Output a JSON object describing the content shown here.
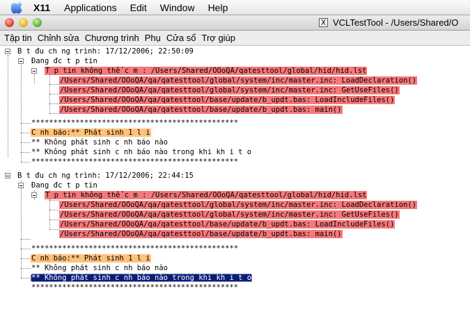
{
  "mac_menubar": {
    "app": "X11",
    "items": [
      "Applications",
      "Edit",
      "Window",
      "Help"
    ]
  },
  "window": {
    "title": "VCLTestTool - /Users/Shared/O"
  },
  "app_menu": {
    "items": [
      "Tập tin",
      "Chỉnh sửa",
      "Chương trình",
      "Phụ",
      "Cửa sổ",
      "Trợ giúp"
    ]
  },
  "tree": {
    "run1": {
      "root": "B t đu ch  ng trình: 17/12/2006; 22:50:09",
      "reading": "Đang đc t p tin",
      "error": "T p tin không thể    c m : /Users/Shared/OOoQA/qatesttool/global/hid/hid.lst",
      "stack": [
        "/Users/Shared/OOoQA/qa/qatesttool/global/system/inc/master.inc: LoadDeclaration()",
        "/Users/Shared/OOoQA/qa/qatesttool/global/system/inc/master.inc: GetUseFiles()",
        "/Users/Shared/OOoQA/qa/qatesttool/base/update/b_updt.bas: LoadIncludeFiles()",
        "/Users/Shared/OOoQA/qa/qatesttool/base/update/b_updt.bas: main()"
      ],
      "sep1": "***********************************************",
      "warning": "C nh báo:** Phát sinh 1 l i",
      "info1": "** Không phát sinh c nh báo nào",
      "info2": "** Không phát sinh c nh báo nào trong khi kh i t o",
      "sep2": "***********************************************"
    },
    "run2": {
      "root": "B t đu ch  ng trình: 17/12/2006; 22:44:15",
      "reading": "Đang đc t p tin",
      "error": "T p tin không thể    c m : /Users/Shared/OOoQA/qatesttool/global/hid/hid.lst",
      "stack": [
        "/Users/Shared/OOoQA/qa/qatesttool/global/system/inc/master.inc: LoadDeclaration()",
        "/Users/Shared/OOoQA/qa/qatesttool/global/system/inc/master.inc: GetUseFiles()",
        "/Users/Shared/OOoQA/qa/qatesttool/base/update/b_updt.bas: LoadIncludeFiles()",
        "/Users/Shared/OOoQA/qa/qatesttool/base/update/b_updt.bas: main()"
      ],
      "sep1": "***********************************************",
      "warning": "C nh báo:** Phát sinh 1 l i",
      "info1": "** Không phát sinh c nh báo nào",
      "info2": "** Không phát sinh c nh báo nào trong khi kh i t o",
      "sep2": "***********************************************"
    }
  },
  "colors": {
    "error_highlight": "#f5797b",
    "warning_highlight": "#ffc27a",
    "selection": "#0a1e78"
  }
}
